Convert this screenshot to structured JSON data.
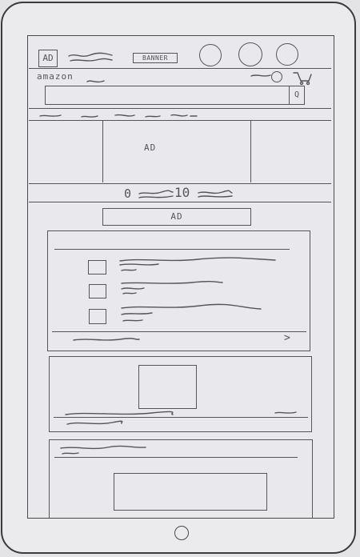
{
  "header": {
    "ad_badge": "AD",
    "banner_label": "BANNER",
    "brand_text": "amazon",
    "search_button_label": "Q"
  },
  "hero": {
    "ad_label": "AD"
  },
  "pager": {
    "current": "0",
    "total": "10"
  },
  "mid_ad": {
    "label": "AD"
  },
  "card_list": {
    "more_arrow": ">"
  },
  "colors": {
    "stroke": "#55545a",
    "paper": "#e9e8ec",
    "frame": "#3b3a3f"
  }
}
